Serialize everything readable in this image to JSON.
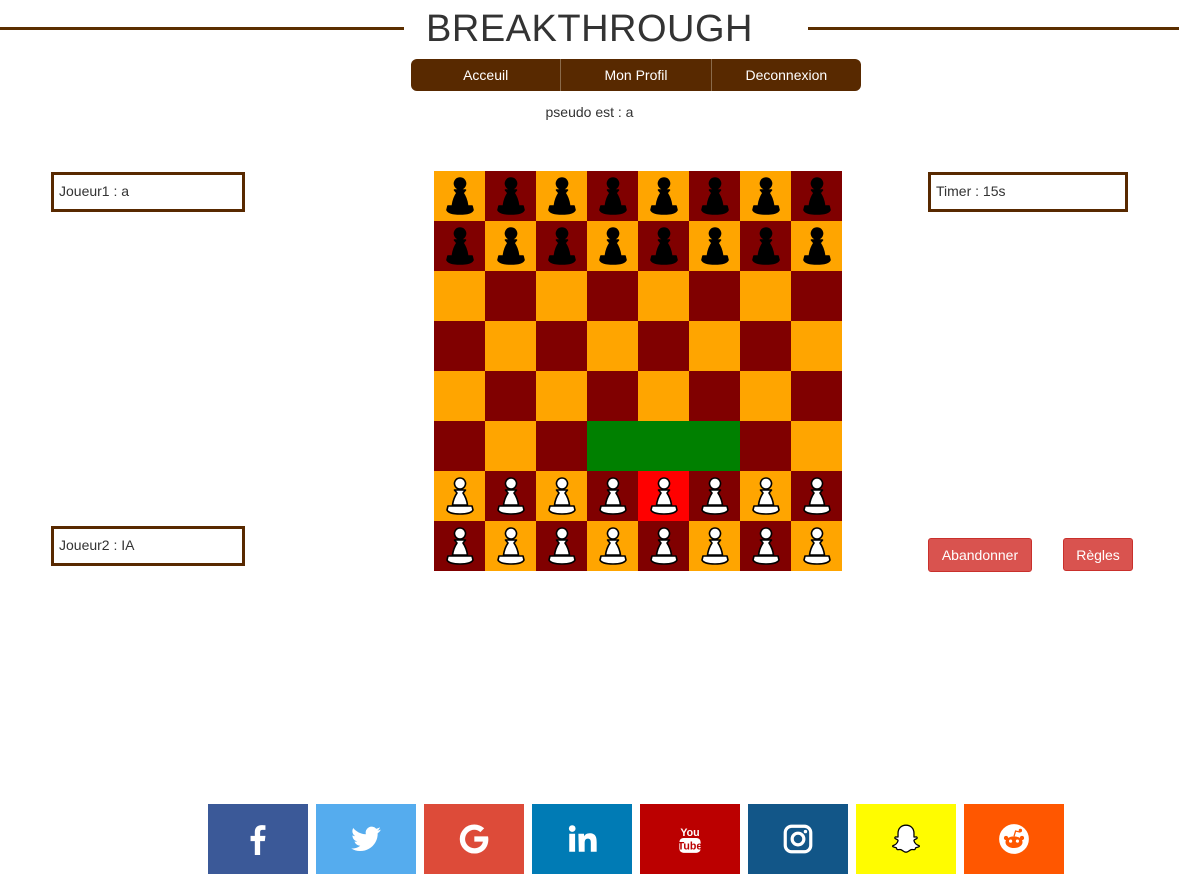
{
  "header": {
    "title": "BREAKTHROUGH"
  },
  "nav": {
    "items": [
      {
        "label": "Acceuil"
      },
      {
        "label": "Mon Profil"
      },
      {
        "label": "Deconnexion"
      }
    ]
  },
  "pseudo_text": "pseudo est : a",
  "players": {
    "player1": "Joueur1 : a",
    "player2": "Joueur2 : IA"
  },
  "timer": "Timer : 15s",
  "buttons": {
    "abandon": "Abandonner",
    "rules": "Règles"
  },
  "board": {
    "colors": {
      "light": "#ffa500",
      "dark": "#800000",
      "highlight": "#008000",
      "selected": "#ff0000"
    },
    "rows": [
      "bbbbbbbb",
      "bbbbbbbb",
      "........",
      "........",
      "........",
      "........",
      "wwwwwwww",
      "wwwwwwww"
    ],
    "selected": [
      6,
      4
    ],
    "highlighted": [
      [
        5,
        3
      ],
      [
        5,
        4
      ],
      [
        5,
        5
      ]
    ]
  },
  "social": [
    {
      "icon": "facebook-icon",
      "color": "#3b5998"
    },
    {
      "icon": "twitter-icon",
      "color": "#55acee"
    },
    {
      "icon": "google-icon",
      "color": "#dd4b39"
    },
    {
      "icon": "linkedin-icon",
      "color": "#007bb5"
    },
    {
      "icon": "youtube-icon",
      "color": "#bb0000"
    },
    {
      "icon": "instagram-icon",
      "color": "#125688"
    },
    {
      "icon": "snapchat-icon",
      "color": "#fffc00"
    },
    {
      "icon": "reddit-icon",
      "color": "#ff5700"
    }
  ]
}
